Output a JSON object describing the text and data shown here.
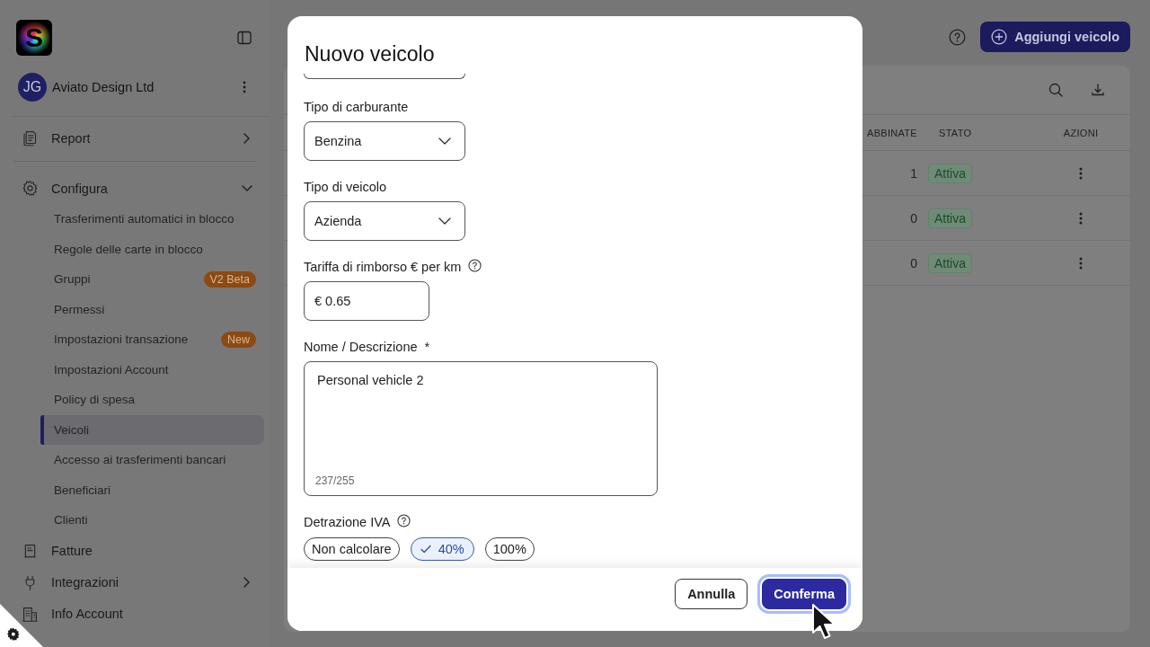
{
  "sidebar": {
    "logo": {
      "letter": "S"
    },
    "org": {
      "initials": "JG",
      "name": "Aviato Design Ltd"
    },
    "items": [
      {
        "label": "Report",
        "selected": false,
        "expanded": false
      },
      {
        "label": "Configura",
        "selected": false,
        "expanded": true,
        "children": [
          {
            "label": "Trasferimenti automatici in blocco",
            "selected": false
          },
          {
            "label": "Regole delle carte in blocco",
            "selected": false
          },
          {
            "label": "Gruppi",
            "selected": false,
            "badge": "V2 Beta"
          },
          {
            "label": "Permessi",
            "selected": false
          },
          {
            "label": "Impostazioni transazione",
            "selected": false,
            "badge": "New"
          },
          {
            "label": "Impostazioni Account",
            "selected": false
          },
          {
            "label": "Policy di spesa",
            "selected": false
          },
          {
            "label": "Veicoli",
            "selected": true
          },
          {
            "label": "Accesso ai trasferimenti bancari",
            "selected": false
          },
          {
            "label": "Beneficiari",
            "selected": false
          },
          {
            "label": "Clienti",
            "selected": false
          }
        ]
      },
      {
        "label": "Fatture",
        "selected": false
      },
      {
        "label": "Integrazioni",
        "selected": false,
        "expanded": false
      },
      {
        "label": "Info Account",
        "selected": false
      }
    ]
  },
  "header": {
    "add_button": "Aggiungi veicolo"
  },
  "table": {
    "columns": [
      "ABBINATE",
      "STATO",
      "AZIONI"
    ],
    "rows": [
      {
        "cells": [
          "1",
          "Attiva"
        ]
      },
      {
        "cells": [
          "0",
          "Attiva"
        ]
      },
      {
        "cells": [
          "0",
          "Attiva"
        ]
      }
    ]
  },
  "dialog": {
    "title": "Nuovo veicolo",
    "fields": [
      {
        "kind": "select",
        "label": "Tipo di carburante",
        "help": false,
        "value": "Benzina"
      },
      {
        "kind": "select",
        "label": "Tipo di veicolo",
        "help": false,
        "value": "Azienda"
      },
      {
        "kind": "input",
        "label": "Tariffa di rimborso € per km",
        "help": true,
        "value": "€ 0.65"
      },
      {
        "kind": "textarea",
        "label": "Nome / Descrizione",
        "required_mark": "*",
        "help": false,
        "value": "Personal vehicle 2",
        "counter": "237/255"
      },
      {
        "kind": "chips",
        "label": "Detrazione IVA",
        "help": true,
        "options": [
          {
            "label": "Non calcolare",
            "selected": false
          },
          {
            "label": "40%",
            "selected": true
          },
          {
            "label": "100%",
            "selected": false
          }
        ]
      }
    ],
    "buttons": [
      {
        "label": "Annulla",
        "kind": "secondary",
        "focused": false
      },
      {
        "label": "Conferma",
        "kind": "primary",
        "focused": true
      }
    ]
  }
}
